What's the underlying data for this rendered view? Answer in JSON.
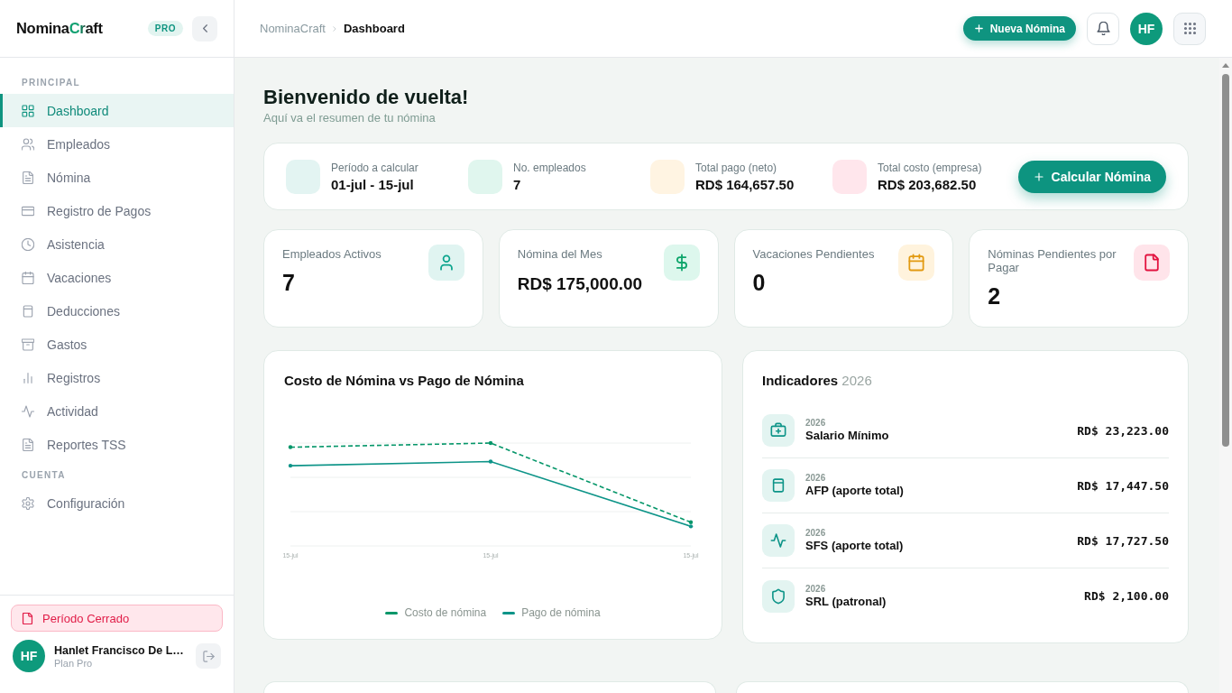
{
  "sidebar": {
    "logo": {
      "name": "Nomina",
      "accent": "Craft"
    },
    "badge": "PRO",
    "sections": [
      {
        "title": "PRINCIPAL",
        "items": [
          {
            "label": "Dashboard",
            "selected": true
          },
          {
            "label": "Empleados",
            "selected": false
          },
          {
            "label": "Nómina",
            "selected": false
          },
          {
            "label": "Registro de Pagos",
            "selected": false
          },
          {
            "label": "Asistencia",
            "selected": false
          },
          {
            "label": "Vacaciones",
            "selected": false
          },
          {
            "label": "Deducciones",
            "selected": false
          },
          {
            "label": "Gastos",
            "selected": false
          },
          {
            "label": "Registros",
            "selected": false
          },
          {
            "label": "Actividad",
            "selected": false
          },
          {
            "label": "Reportes TSS",
            "selected": false
          }
        ]
      },
      {
        "title": "CUENTA",
        "items": [
          {
            "label": "Configuración",
            "selected": false
          }
        ]
      }
    ],
    "period_status": "Período Cerrado",
    "user": {
      "initials": "HF",
      "name": "Hanlet Francisco De L…",
      "plan": "Plan Pro"
    }
  },
  "topbar": {
    "breadcrumb": [
      "NominaCraft",
      "Dashboard"
    ],
    "new_button": "Nueva Nómina",
    "avatar_initials": "HF"
  },
  "header": {
    "title": "Bienvenido de vuelta!",
    "subtitle": "Aquí va el resumen de tu nómina"
  },
  "summary": {
    "items": [
      {
        "label": "Período a calcular",
        "value": "01-jul - 15-jul",
        "color": "#e3f4f2"
      },
      {
        "label": "No. empleados",
        "value": "7",
        "color": "#e0f6ee"
      },
      {
        "label": "Total pago (neto)",
        "value": "RD$ 164,657.50",
        "color": "#fff4e2"
      },
      {
        "label": "Total costo (empresa)",
        "value": "RD$ 203,682.50",
        "color": "#ffe6ec"
      }
    ],
    "button": "Calcular Nómina"
  },
  "stats": [
    {
      "label": "Empleados Activos",
      "value": "7",
      "color": "#e0f4f1"
    },
    {
      "label": "Nómina del Mes",
      "value": "RD$ 175,000.00",
      "color": "#ddf7ed"
    },
    {
      "label": "Vacaciones Pendientes",
      "value": "0",
      "color": "#fff3dd"
    },
    {
      "label": "Nóminas Pendientes por Pagar",
      "value": "2",
      "color": "#ffe4ea"
    }
  ],
  "chart": {
    "title": "Costo de Nómina vs Pago de Nómina",
    "x_labels": [
      "15-jul",
      "15-jul",
      "15-jul"
    ],
    "legend": [
      {
        "name": "Costo de nómina",
        "color": "#059669",
        "kind": "dashed"
      },
      {
        "name": "Pago de nómina",
        "color": "#0d9488",
        "kind": "solid"
      }
    ]
  },
  "indicators": {
    "title": "Indicadores",
    "year": "2026",
    "rows": [
      {
        "year": "2026",
        "name": "Salario Mínimo",
        "value": "RD$ 23,223.00"
      },
      {
        "year": "2026",
        "name": "AFP (aporte total)",
        "value": "RD$ 17,447.50"
      },
      {
        "year": "2026",
        "name": "SFS (aporte total)",
        "value": "RD$ 17,727.50"
      },
      {
        "year": "2026",
        "name": "SRL (patronal)",
        "value": "RD$ 2,100.00"
      }
    ]
  }
}
